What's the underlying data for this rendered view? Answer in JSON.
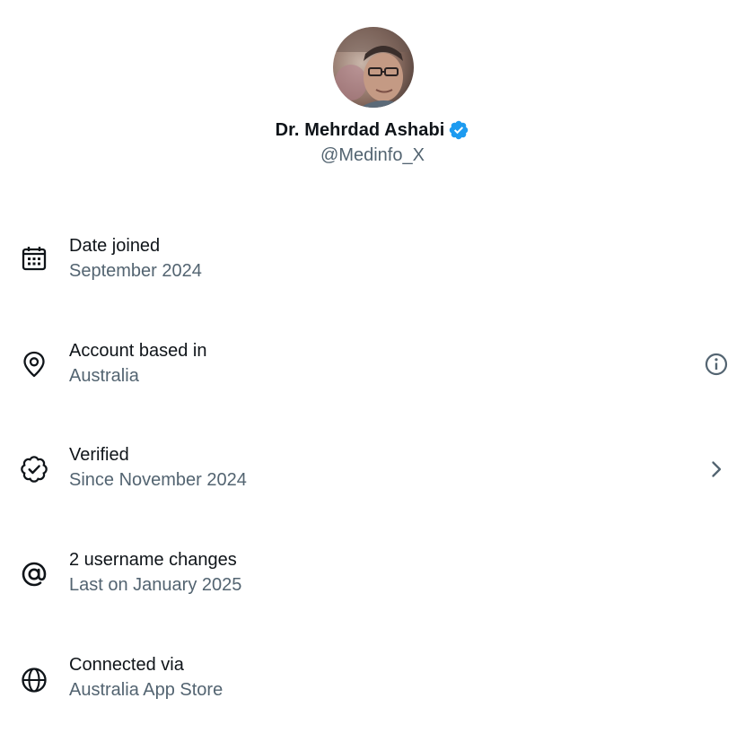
{
  "profile": {
    "display_name": "Dr. Mehrdad Ashabi",
    "handle": "@Medinfo_X",
    "verified": true,
    "verified_color": "#1d9bf0"
  },
  "info": [
    {
      "icon": "calendar-icon",
      "title": "Date joined",
      "subtitle": "September 2024",
      "action": null
    },
    {
      "icon": "location-pin-icon",
      "title": "Account based in",
      "subtitle": "Australia",
      "action": "info-icon"
    },
    {
      "icon": "verified-badge-outline-icon",
      "title": "Verified",
      "subtitle": "Since November 2024",
      "action": "chevron-right-icon"
    },
    {
      "icon": "at-sign-icon",
      "title": "2 username changes",
      "subtitle": "Last on January 2025",
      "action": null
    },
    {
      "icon": "globe-icon",
      "title": "Connected via",
      "subtitle": "Australia App Store",
      "action": null
    }
  ],
  "colors": {
    "primary_text": "#0f1419",
    "secondary_text": "#536471"
  }
}
